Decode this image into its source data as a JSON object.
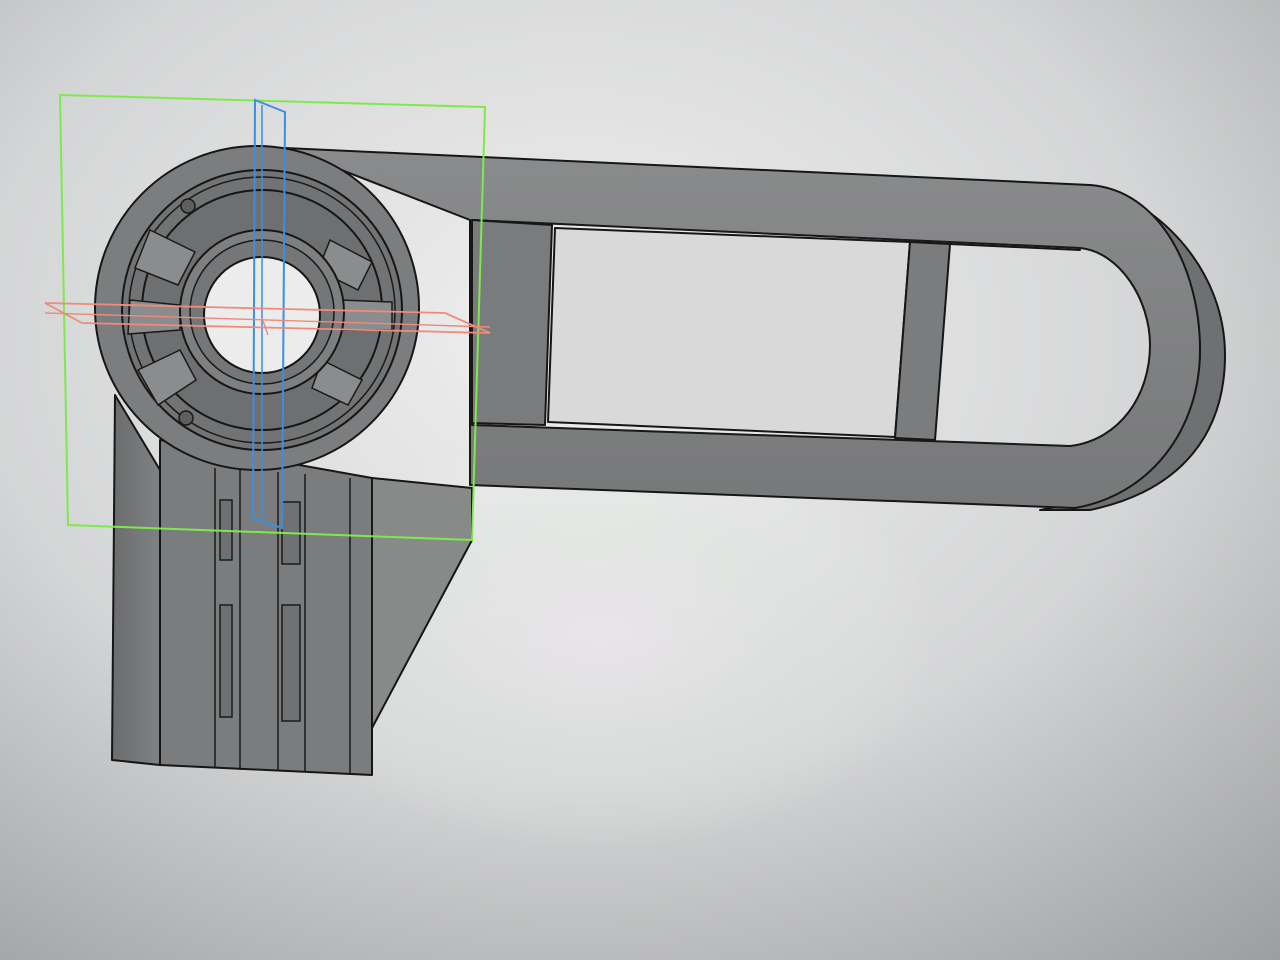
{
  "app": {
    "view": "cad-3d-viewport"
  },
  "colors": {
    "background_light": "#e8e8e8",
    "background_dark": "#9a9b9c",
    "part_face": "#7c7d7e",
    "part_face_dark": "#6a6b6c",
    "part_face_light": "#8c8d8e",
    "edge": "#161616",
    "bounding_box": "#7dea4a",
    "plane_blue": "#3b8fe0",
    "plane_red": "#f08a7a"
  },
  "model": {
    "part": "bracket-arm",
    "features": [
      "hub-ring",
      "center-bore",
      "spoke-slots",
      "arm-slot",
      "cross-bar",
      "mounting-base",
      "base-slots"
    ],
    "reference_geometry": [
      "bounding-box",
      "vertical-plane",
      "horizontal-plane"
    ]
  }
}
